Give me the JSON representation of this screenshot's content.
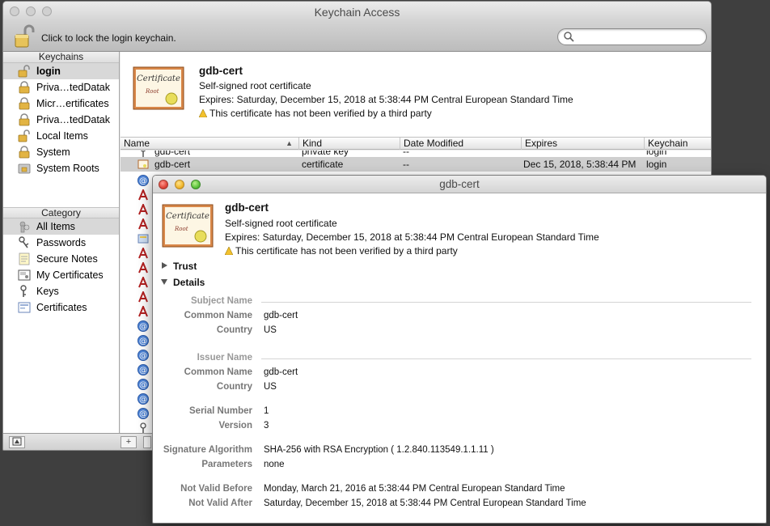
{
  "main_window": {
    "title": "Keychain Access",
    "lock_text": "Click to lock the login keychain.",
    "search_placeholder": ""
  },
  "sidebar": {
    "keychains_header": "Keychains",
    "keychains": [
      {
        "label": "login",
        "icon": "lock-open-icon"
      },
      {
        "label": "Priva…tedDatak",
        "icon": "lock-icon"
      },
      {
        "label": "Micr…ertificates",
        "icon": "lock-icon"
      },
      {
        "label": "Priva…tedDatak",
        "icon": "lock-icon"
      },
      {
        "label": "Local Items",
        "icon": "lock-open-icon"
      },
      {
        "label": "System",
        "icon": "lock-icon"
      },
      {
        "label": "System Roots",
        "icon": "folder-lock-icon"
      }
    ],
    "category_header": "Category",
    "categories": [
      {
        "label": "All Items",
        "icon": "all-items-icon"
      },
      {
        "label": "Passwords",
        "icon": "key-icon"
      },
      {
        "label": "Secure Notes",
        "icon": "note-icon"
      },
      {
        "label": "My Certificates",
        "icon": "my-certificate-icon"
      },
      {
        "label": "Keys",
        "icon": "keys-icon"
      },
      {
        "label": "Certificates",
        "icon": "certificate-icon"
      }
    ]
  },
  "summary": {
    "name": "gdb-cert",
    "type": "Self-signed root certificate",
    "expires": "Expires: Saturday, December 15, 2018 at 5:38:44 PM Central European Standard Time",
    "warning": "This certificate has not been verified by a third party",
    "cert_image_text": "Certificate",
    "cert_image_sub": "Root"
  },
  "table": {
    "columns": [
      "Name",
      "Kind",
      "Date Modified",
      "Expires",
      "Keychain"
    ],
    "rows": [
      {
        "name": "gdb-cert",
        "kind": "private key",
        "date": "--",
        "expires": "",
        "keychain": "login"
      },
      {
        "name": "gdb-cert",
        "kind": "certificate",
        "date": "--",
        "expires": "Dec 15, 2018, 5:38:44 PM",
        "keychain": "login"
      }
    ]
  },
  "detail_window": {
    "title": "gdb-cert",
    "name": "gdb-cert",
    "type": "Self-signed root certificate",
    "expires": "Expires: Saturday, December 15, 2018 at 5:38:44 PM Central European Standard Time",
    "warning": "This certificate has not been verified by a third party",
    "trust_label": "Trust",
    "details_label": "Details",
    "subject_name_header": "Subject Name",
    "subject": {
      "common_name_label": "Common Name",
      "common_name": "gdb-cert",
      "country_label": "Country",
      "country": "US"
    },
    "issuer_name_header": "Issuer Name",
    "issuer": {
      "common_name_label": "Common Name",
      "common_name": "gdb-cert",
      "country_label": "Country",
      "country": "US"
    },
    "serial_label": "Serial Number",
    "serial": "1",
    "version_label": "Version",
    "version": "3",
    "sig_alg_label": "Signature Algorithm",
    "sig_alg": "SHA-256 with RSA Encryption ( 1.2.840.113549.1.1.11 )",
    "params_label": "Parameters",
    "params": "none",
    "not_before_label": "Not Valid Before",
    "not_before": "Monday, March 21, 2016 at 5:38:44 PM Central European Standard Time",
    "not_after_label": "Not Valid After",
    "not_after": "Saturday, December 15, 2018 at 5:38:44 PM Central European Standard Time"
  }
}
